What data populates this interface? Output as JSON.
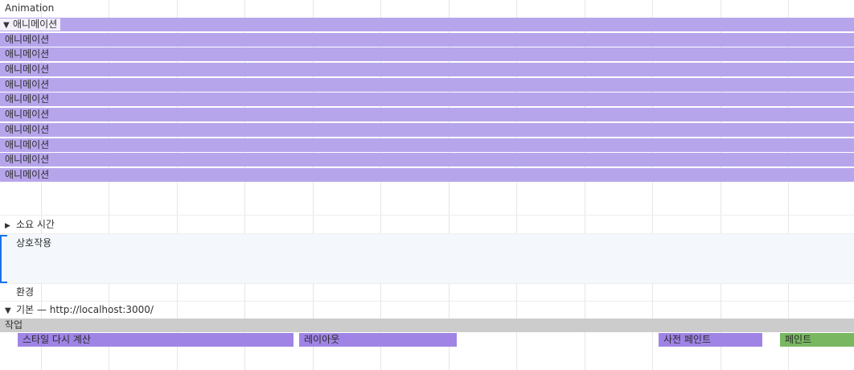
{
  "header": {
    "title": "Animation"
  },
  "animations": {
    "group_label": "애니메이션",
    "items": [
      "애니메이션",
      "애니메이션",
      "애니메이션",
      "애니메이션",
      "애니메이션",
      "애니메이션",
      "애니메이션",
      "애니메이션",
      "애니메이션",
      "애니메이션"
    ]
  },
  "sections": {
    "duration": "소요 시간",
    "interactions": "상호작용",
    "environment": "환경",
    "main": "기본 — http://localhost:3000/"
  },
  "tasks": {
    "label": "작업",
    "blocks": [
      "스타일 다시 계산",
      "레이아웃",
      "사전 페인트",
      "페인트"
    ]
  },
  "colors": {
    "animation": "#b7a5ec",
    "task_purple": "#9f84e6",
    "task_green": "#79b861",
    "bracket": "#1a73e8"
  }
}
